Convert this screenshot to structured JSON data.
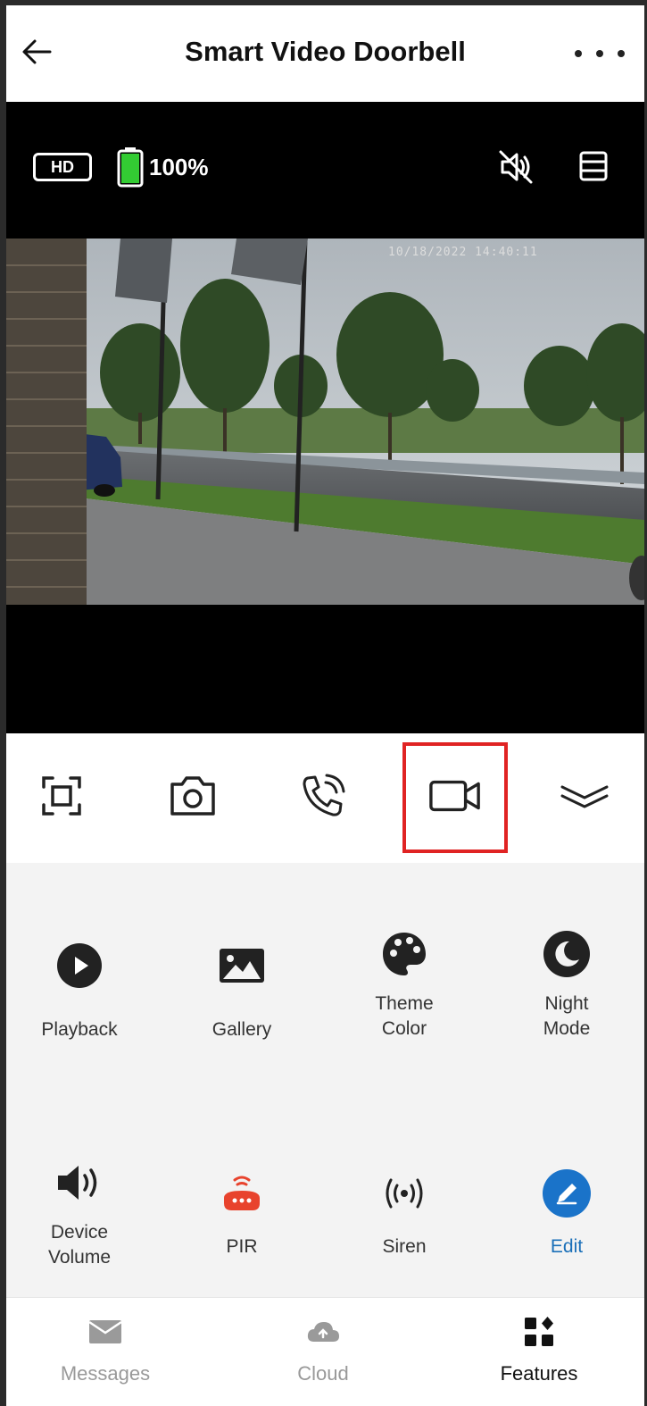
{
  "header": {
    "title": "Smart Video Doorbell"
  },
  "video": {
    "quality": "HD",
    "battery_text": "100%",
    "battery_level": 1.0,
    "timestamp": "10/18/2022 14:40:11",
    "colors": {
      "battery": "#33cc33"
    }
  },
  "controls": {
    "items": [
      {
        "name": "fullscreen-icon"
      },
      {
        "name": "camera-icon"
      },
      {
        "name": "phone-icon"
      },
      {
        "name": "video-record-icon"
      },
      {
        "name": "collapse-icon"
      }
    ],
    "highlight_color": "#e02323"
  },
  "features": {
    "items": [
      {
        "label": "Playback",
        "icon": "play-icon"
      },
      {
        "label": "Gallery",
        "icon": "image-icon"
      },
      {
        "label": "Theme\nColor",
        "icon": "palette-icon"
      },
      {
        "label": "Night\nMode",
        "icon": "moon-icon"
      },
      {
        "label": "Device\nVolume",
        "icon": "speaker-icon"
      },
      {
        "label": "PIR",
        "icon": "pir-sensor-icon"
      },
      {
        "label": "Siren",
        "icon": "siren-icon"
      },
      {
        "label": "Edit",
        "icon": "edit-icon"
      }
    ],
    "colors": {
      "pir": "#e8432d",
      "edit": "#1a73c9",
      "edit_label": "#1a6fb8"
    }
  },
  "bottom_nav": {
    "tabs": [
      {
        "label": "Messages",
        "icon": "mail-icon"
      },
      {
        "label": "Cloud",
        "icon": "cloud-icon"
      },
      {
        "label": "Features",
        "icon": "grid-icon"
      }
    ],
    "active": "Features"
  }
}
